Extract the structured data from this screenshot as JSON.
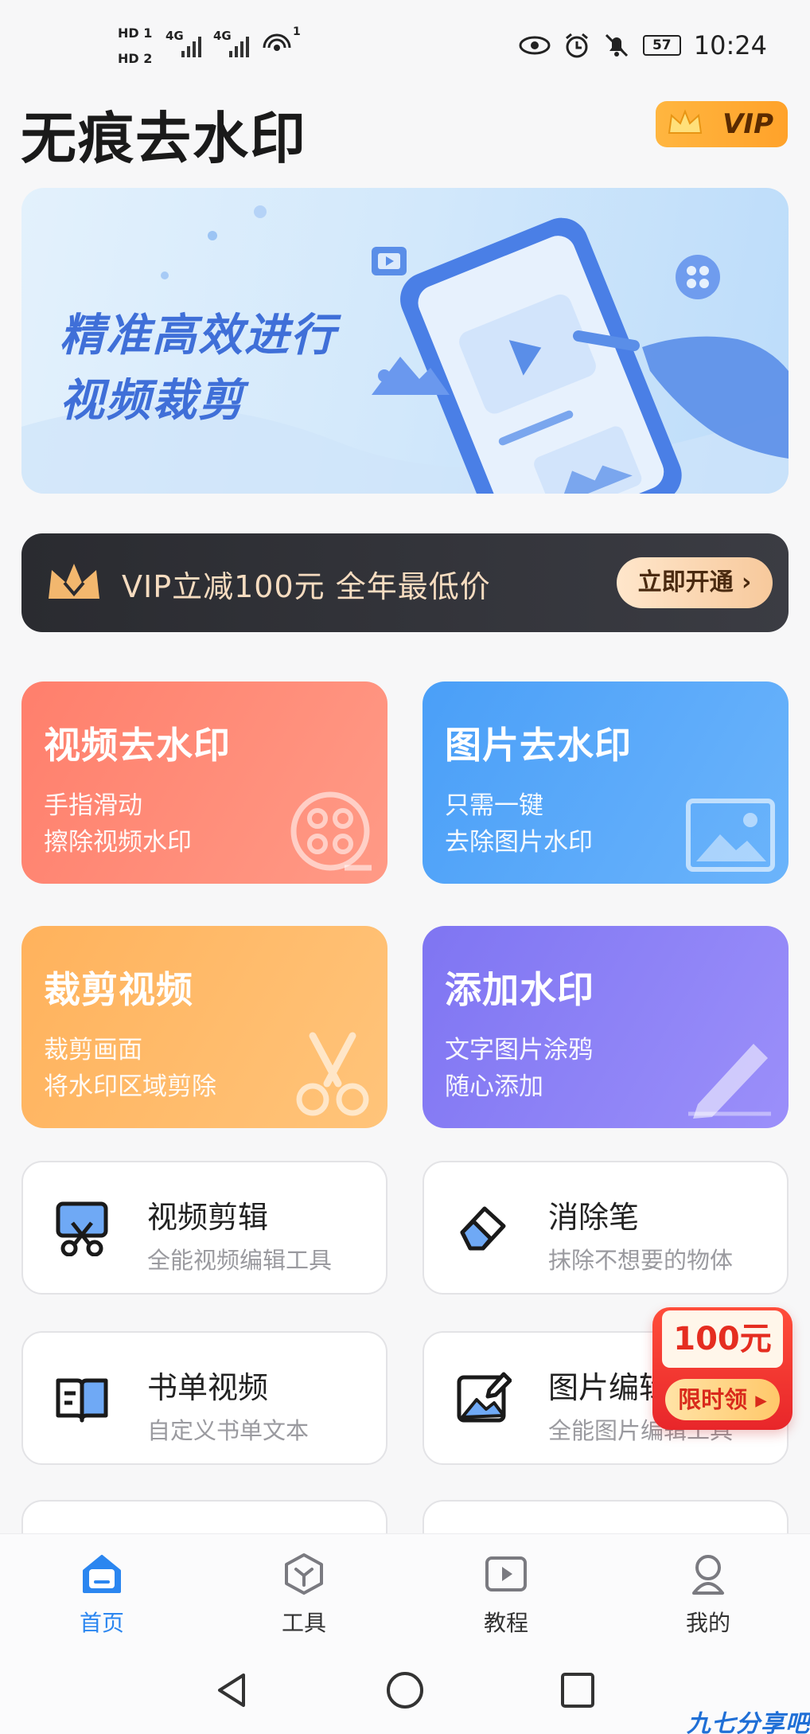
{
  "status_bar": {
    "hd1": "HD 1",
    "hd2": "HD 2",
    "net1": "4G",
    "net2": "4G",
    "hotspot_sup": "1",
    "battery": "57",
    "time": "10:24"
  },
  "header": {
    "title": "无痕去水印",
    "vip_label": "VIP"
  },
  "banner": {
    "line1": "精准高效进行",
    "line2": "视频裁剪"
  },
  "vip_strip": {
    "text": "VIP立减100元  全年最低价",
    "button": "立即开通"
  },
  "features": [
    {
      "title": "视频去水印",
      "desc1": "手指滑动",
      "desc2": "擦除视频水印",
      "icon": "film-reel-icon"
    },
    {
      "title": "图片去水印",
      "desc1": "只需一键",
      "desc2": "去除图片水印",
      "icon": "picture-icon"
    },
    {
      "title": "裁剪视频",
      "desc1": "裁剪画面",
      "desc2": "将水印区域剪除",
      "icon": "scissors-icon"
    },
    {
      "title": "添加水印",
      "desc1": "文字图片涂鸦",
      "desc2": "随心添加",
      "icon": "pencil-icon"
    }
  ],
  "tools": [
    {
      "title": "视频剪辑",
      "desc": "全能视频编辑工具",
      "icon": "video-cut-icon"
    },
    {
      "title": "消除笔",
      "desc": "抹除不想要的物体",
      "icon": "eraser-icon"
    },
    {
      "title": "书单视频",
      "desc": "自定义书单文本",
      "icon": "book-icon"
    },
    {
      "title": "图片编辑",
      "desc": "全能图片编辑工具",
      "icon": "image-edit-icon"
    }
  ],
  "coupon": {
    "amount": "100元",
    "button": "限时领"
  },
  "bottom_nav": [
    {
      "label": "首页",
      "icon": "home-icon",
      "active": true
    },
    {
      "label": "工具",
      "icon": "cube-icon",
      "active": false
    },
    {
      "label": "教程",
      "icon": "play-icon",
      "active": false
    },
    {
      "label": "我的",
      "icon": "profile-icon",
      "active": false
    }
  ],
  "watermark": "九七分享吧",
  "colors": {
    "accent": "#2b86f0",
    "vip_gold": "#ffa22a",
    "card_video": "#ff7f6c",
    "card_image": "#4a9ff8",
    "card_crop": "#ffb25c",
    "card_add": "#7f75f2"
  }
}
